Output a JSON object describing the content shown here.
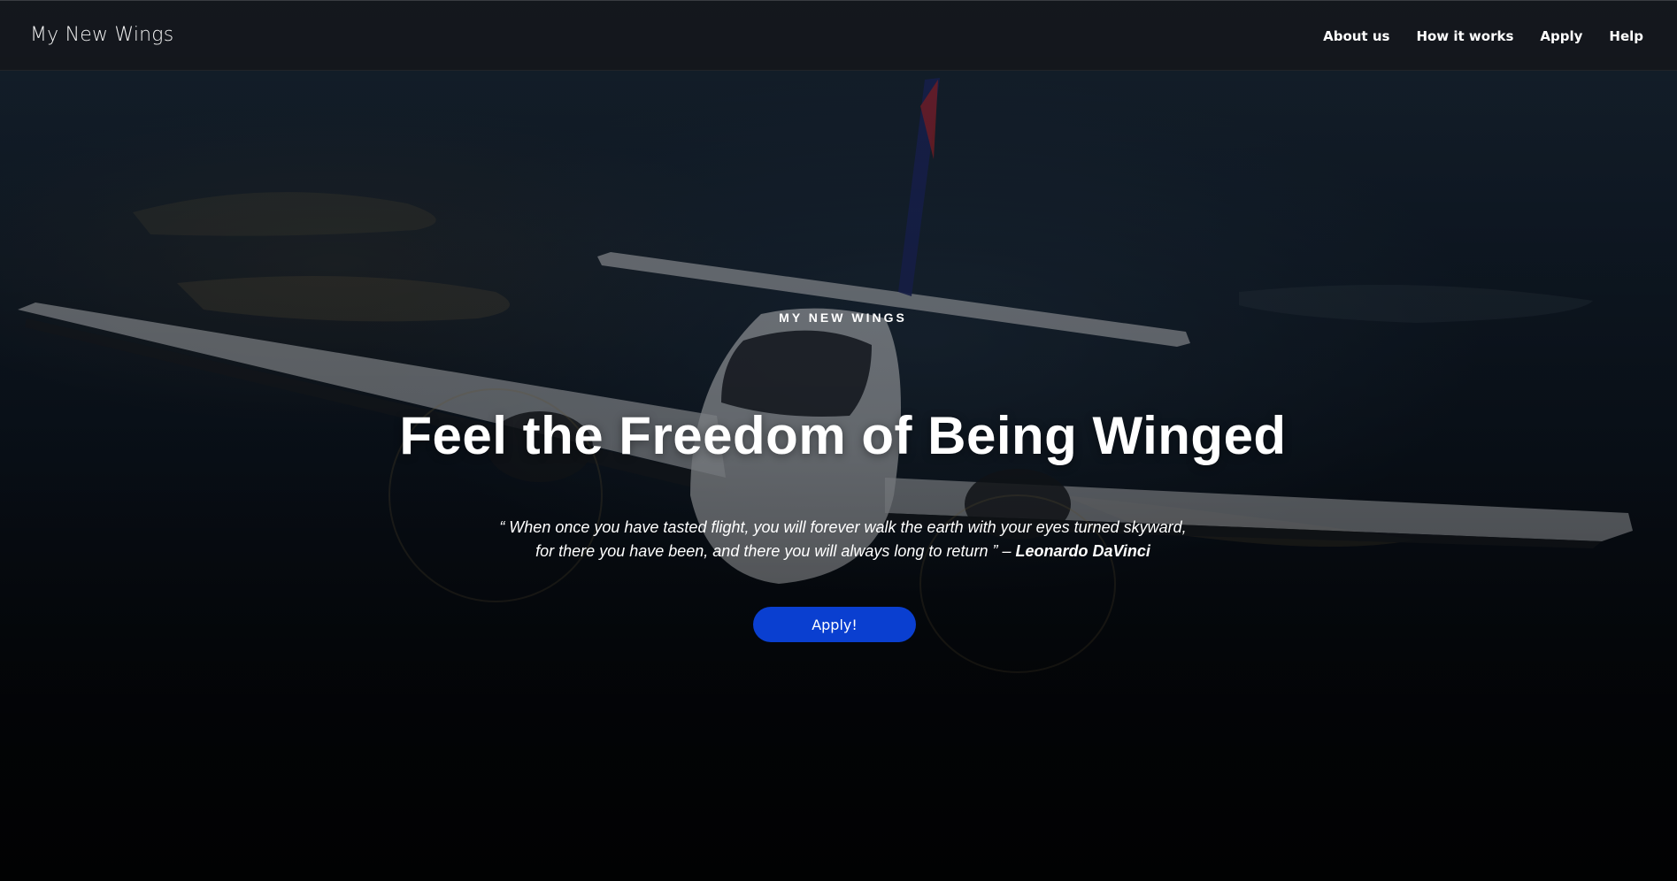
{
  "navbar": {
    "brand": "My New Wings",
    "links": [
      {
        "label": "About us"
      },
      {
        "label": "How it works"
      },
      {
        "label": "Apply"
      },
      {
        "label": "Help"
      }
    ]
  },
  "hero": {
    "eyebrow": "MY NEW WINGS",
    "headline": "Feel the Freedom of Being Winged",
    "quote_line1": "“ When once you have tasted flight, you will forever walk the earth with your eyes turned skyward,",
    "quote_line2": "for there you have been, and there you will always long to return ” –",
    "quote_author": "Leonardo DaVinci",
    "cta_label": "Apply!",
    "background_icon": "airplane-photo"
  },
  "colors": {
    "cta_background": "#0a3fd0",
    "navbar_background": "#1a1c20",
    "text": "#ffffff"
  }
}
